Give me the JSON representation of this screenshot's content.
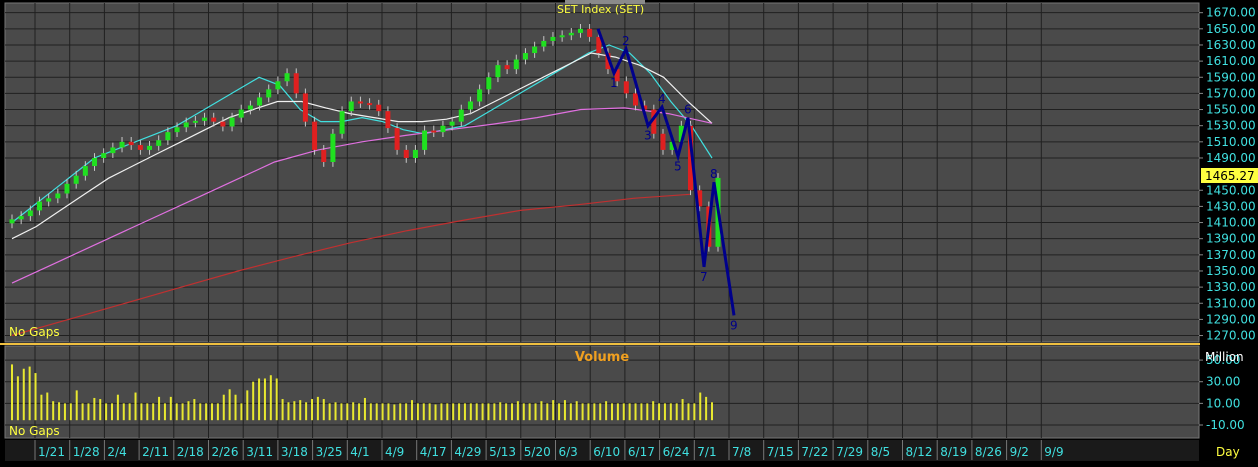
{
  "chart_data": [
    {
      "type": "candlestick",
      "title": "SET Index (SET)",
      "note": "No Gaps",
      "last_value": "1465.27",
      "y_ticks": [
        1670,
        1650,
        1630,
        1610,
        1590,
        1570,
        1550,
        1530,
        1510,
        1490,
        1450,
        1430,
        1410,
        1390,
        1370,
        1350,
        1330,
        1310,
        1290,
        1270
      ],
      "ylim": [
        1262,
        1682
      ],
      "x_tick_labels": [
        "1/21",
        "1/28",
        "2/4",
        "2/11",
        "2/18",
        "2/26",
        "3/11",
        "3/18",
        "3/25",
        "4/1",
        "4/9",
        "4/17",
        "4/29",
        "5/13",
        "5/20",
        "6/3",
        "6/10",
        "6/17",
        "6/24",
        "7/1",
        "7/8",
        "7/15",
        "7/22",
        "7/29",
        "8/5",
        "8/12",
        "8/19",
        "8/26",
        "9/2",
        "9/9"
      ],
      "series": [
        {
          "kind": "candles",
          "approx_close": [
            1414,
            1418,
            1425,
            1436,
            1440,
            1446,
            1458,
            1468,
            1480,
            1490,
            1496,
            1503,
            1510,
            1506,
            1500,
            1505,
            1512,
            1522,
            1528,
            1534,
            1536,
            1540,
            1535,
            1529,
            1540,
            1550,
            1555,
            1565,
            1575,
            1585,
            1595,
            1570,
            1535,
            1500,
            1485,
            1520,
            1548,
            1560,
            1558,
            1556,
            1548,
            1527,
            1500,
            1490,
            1500,
            1524,
            1522,
            1530,
            1535,
            1550,
            1560,
            1575,
            1590,
            1605,
            1600,
            1612,
            1620,
            1628,
            1635,
            1640,
            1642,
            1645,
            1650,
            1640,
            1620,
            1600,
            1585,
            1570,
            1555,
            1550,
            1520,
            1500,
            1510,
            1530,
            1450,
            1430,
            1380,
            1465.27
          ]
        },
        {
          "kind": "moving-average",
          "color": "#40e0e0",
          "approx_values": [
            1410,
            1430,
            1450,
            1470,
            1490,
            1500,
            1510,
            1520,
            1530,
            1545,
            1560,
            1575,
            1590,
            1580,
            1550,
            1535,
            1535,
            1540,
            1535,
            1525,
            1520,
            1525,
            1530,
            1545,
            1560,
            1575,
            1590,
            1605,
            1620,
            1630,
            1620,
            1595,
            1560,
            1530,
            1490
          ]
        },
        {
          "kind": "moving-average",
          "color": "#f0f0f0",
          "approx_values": [
            1390,
            1405,
            1425,
            1445,
            1465,
            1480,
            1495,
            1510,
            1525,
            1540,
            1550,
            1560,
            1560,
            1552,
            1545,
            1540,
            1535,
            1535,
            1538,
            1545,
            1560,
            1575,
            1590,
            1605,
            1620,
            1615,
            1605,
            1590,
            1560,
            1533
          ]
        },
        {
          "kind": "moving-average",
          "color": "#e070e0",
          "approx_values": [
            1335,
            1360,
            1385,
            1410,
            1435,
            1460,
            1485,
            1500,
            1510,
            1518,
            1525,
            1532,
            1540,
            1550,
            1552,
            1545,
            1533
          ]
        },
        {
          "kind": "moving-average",
          "color": "#c03030",
          "approx_values": [
            1270,
            1290,
            1310,
            1330,
            1350,
            1368,
            1385,
            1400,
            1413,
            1425,
            1432,
            1440,
            1445
          ]
        },
        {
          "kind": "wave-count",
          "color": "#00008b",
          "labels": [
            "1",
            "2",
            "3",
            "4",
            "5",
            "6",
            "7",
            "8",
            "9"
          ],
          "approx_values": [
            1650,
            1595,
            1625,
            1530,
            1553,
            1492,
            1540,
            1355,
            1460,
            1295
          ]
        }
      ]
    },
    {
      "type": "bar",
      "title": "Volume",
      "note": "No Gaps",
      "unit_label": "Million",
      "y_ticks": [
        "50.00",
        "30.00",
        "10.00",
        "-10.00"
      ],
      "y_tick_values": [
        50,
        30,
        10,
        -10
      ],
      "ylim": [
        -22,
        63
      ],
      "values": [
        46,
        35,
        42,
        44,
        38,
        18,
        20,
        12,
        11,
        10,
        10,
        22,
        10,
        10,
        15,
        14,
        10,
        10,
        18,
        10,
        10,
        20,
        10,
        10,
        10,
        16,
        10,
        16,
        10,
        10,
        12,
        14,
        10,
        10,
        10,
        10,
        18,
        23,
        18,
        10,
        22,
        30,
        33,
        33,
        36,
        33,
        14,
        11,
        12,
        13,
        11,
        14,
        16,
        14,
        10,
        11,
        10,
        10,
        11,
        10,
        15,
        10,
        10,
        10,
        10,
        9,
        10,
        10,
        13,
        10,
        10,
        10,
        9,
        10,
        10,
        10,
        10,
        10,
        10,
        10,
        10,
        10,
        10,
        11,
        10,
        10,
        12,
        10,
        10,
        10,
        12,
        10,
        13,
        10,
        13,
        10,
        12,
        10,
        10,
        10,
        10,
        12,
        10,
        10,
        10,
        10,
        10,
        10,
        10,
        12,
        10,
        10,
        10,
        10,
        14,
        10,
        10,
        20,
        16,
        11
      ]
    }
  ],
  "x_axis_unit": "Day"
}
